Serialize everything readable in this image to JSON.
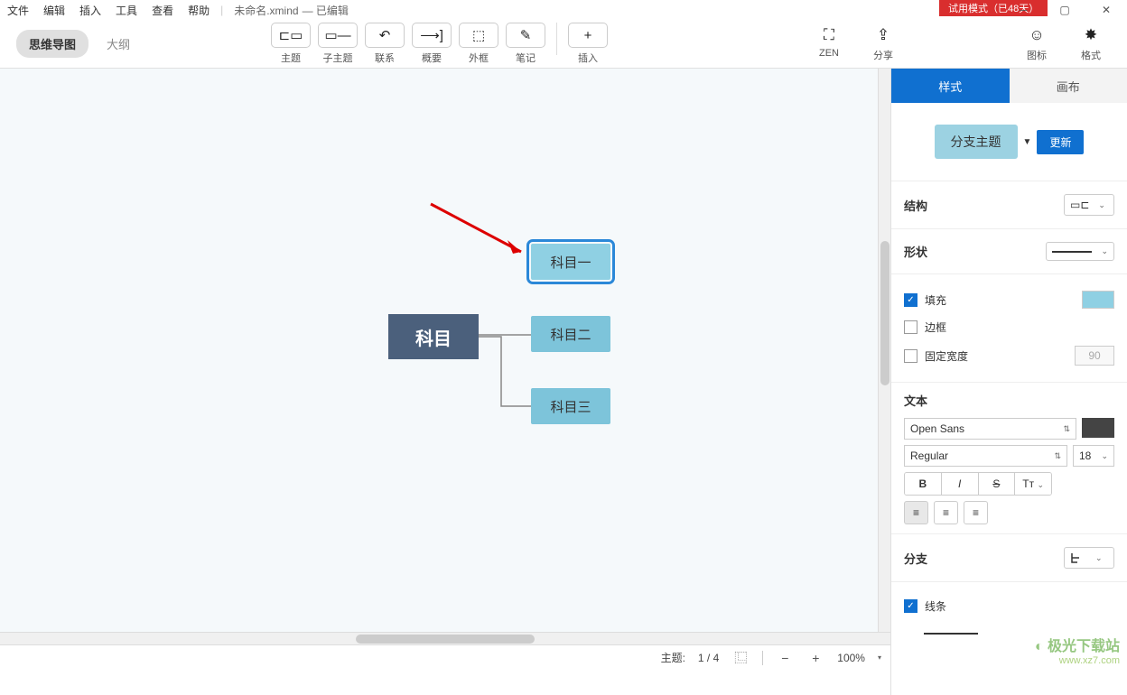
{
  "menu": {
    "file": "文件",
    "edit": "编辑",
    "insert": "插入",
    "tools": "工具",
    "view": "查看",
    "help": "帮助"
  },
  "document": {
    "name": "未命名.xmind",
    "state": "— 已编辑"
  },
  "trial": "试用模式（已48天）",
  "viewtabs": {
    "mindmap": "思维导图",
    "outline": "大纲"
  },
  "toolbar": {
    "topic": "主题",
    "subtopic": "子主题",
    "relationship": "联系",
    "summary": "概要",
    "boundary": "外框",
    "notes": "笔记",
    "insert": "插入",
    "zen": "ZEN",
    "share": "分享",
    "icons": "图标",
    "format": "格式"
  },
  "mindmap": {
    "central": "科目",
    "nodes": [
      "科目一",
      "科目二",
      "科目三"
    ]
  },
  "statusbar": {
    "topic_label": "主题:",
    "topic_count": "1 / 4",
    "zoom": "100%"
  },
  "panel": {
    "tab_style": "样式",
    "tab_canvas": "画布",
    "topic_type": "分支主题",
    "update": "更新",
    "structure": "结构",
    "shape": "形状",
    "fill": "填充",
    "border": "边框",
    "fixed_width": "固定宽度",
    "width_value": "90",
    "text": "文本",
    "font": "Open Sans",
    "weight": "Regular",
    "size": "18",
    "branch": "分支",
    "line": "线条"
  },
  "watermark": "www.xz7.com"
}
